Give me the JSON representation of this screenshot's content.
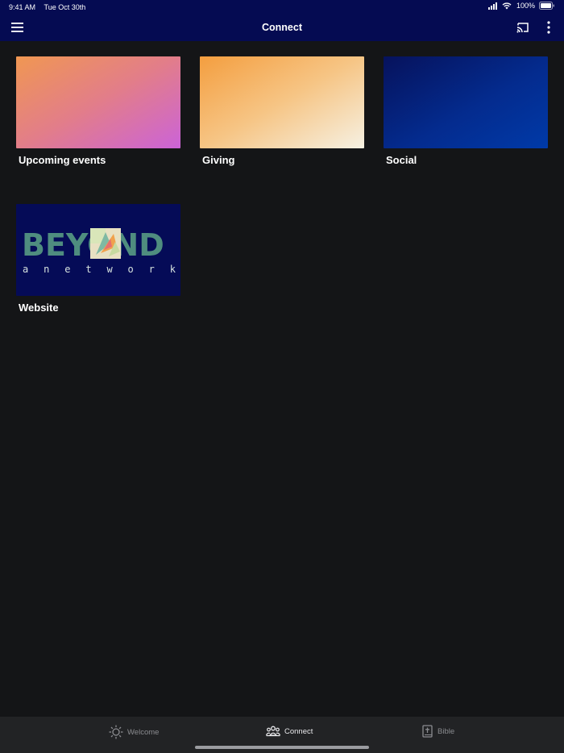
{
  "status_bar": {
    "time": "9:41 AM",
    "date": "Tue Oct 30th",
    "battery": "100%",
    "icons": [
      "signal-icon",
      "wifi-icon",
      "battery-icon"
    ]
  },
  "app_bar": {
    "title": "Connect",
    "background": "#050b52",
    "icons": [
      "menu-icon",
      "cast-icon",
      "more-vert-icon"
    ]
  },
  "tiles": [
    {
      "label": "Upcoming events",
      "image": "gradient-orange-pink"
    },
    {
      "label": "Giving",
      "image": "gradient-orange-cream"
    },
    {
      "label": "Social",
      "image": "gradient-navy-blue"
    },
    {
      "label": "Website",
      "image": "beyond-logo",
      "logo_word": "BEYOND",
      "logo_sub": "a network"
    }
  ],
  "tab_bar": {
    "tabs": [
      {
        "label": "Welcome",
        "icon": "sun-icon",
        "active": false
      },
      {
        "label": "Connect",
        "icon": "people-icon",
        "active": true
      },
      {
        "label": "Bible",
        "icon": "bible-icon",
        "active": false
      }
    ]
  },
  "colors": {
    "background": "#141517",
    "tab_bar": "#222325",
    "logo_green": "#4f8d7f"
  }
}
